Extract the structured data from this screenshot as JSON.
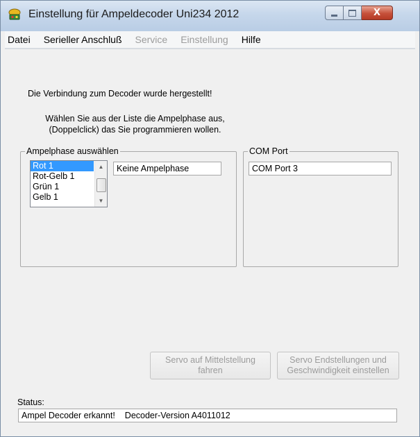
{
  "window": {
    "title": "Einstellung für Ampeldecoder Uni234 2012",
    "controls": {
      "minimize": "minimize-icon",
      "maximize": "maximize-icon",
      "close": "X"
    }
  },
  "menu": {
    "items": [
      {
        "label": "Datei",
        "enabled": true
      },
      {
        "label": "Serieller Anschluß",
        "enabled": true
      },
      {
        "label": "Service",
        "enabled": false
      },
      {
        "label": "Einstellung",
        "enabled": false
      },
      {
        "label": "Hilfe",
        "enabled": true
      }
    ]
  },
  "messages": {
    "connected": "Die Verbindung zum Decoder wurde hergestellt!",
    "instruction_line1": "Wählen Sie aus der Liste die Ampelphase aus,",
    "instruction_line2": "(Doppelclick) das Sie programmieren wollen."
  },
  "phase_group": {
    "legend": "Ampelphase auswählen",
    "list_items": [
      "Rot 1",
      "Rot-Gelb 1",
      "Grün 1",
      "Gelb 1"
    ],
    "selected_index": 0,
    "current_phase": "Keine Ampelphase"
  },
  "com_group": {
    "legend": "COM Port",
    "value": "COM Port 3"
  },
  "buttons": {
    "servo_mid_line1": "Servo auf Mittelstellung",
    "servo_mid_line2": "fahren",
    "servo_end_line1": "Servo Endstellungen und",
    "servo_end_line2": "Geschwindigkeit einstellen"
  },
  "status": {
    "label": "Status:",
    "text1": "Ampel Decoder erkannt!",
    "text2": "Decoder-Version A4011012"
  },
  "colors": {
    "selection": "#3399ff",
    "disabled_text": "#9c9c9c",
    "close_button": "#c6503a"
  }
}
